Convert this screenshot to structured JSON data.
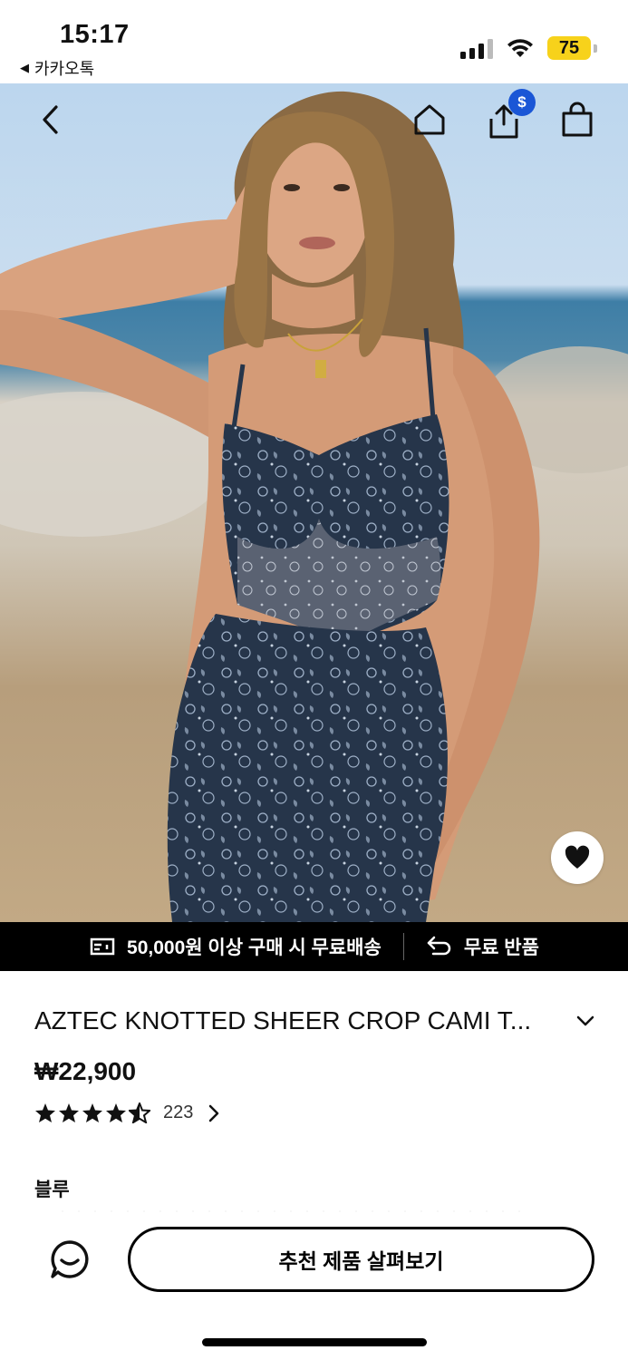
{
  "status_bar": {
    "time": "15:17",
    "back_app_label": "카카오톡",
    "battery_level": "75",
    "battery_color": "#f7d21b",
    "icons": [
      "signal-icon",
      "wifi-icon",
      "battery-icon"
    ]
  },
  "header": {
    "icons": [
      "back-chevron-icon",
      "home-icon",
      "share-icon",
      "shopping-bag-icon"
    ],
    "share_badge": "$",
    "share_badge_color": "#1a56d6"
  },
  "hero": {
    "image_name": "product-photo",
    "wishlist_icon": "heart-icon"
  },
  "promo_bar": {
    "shipping_text": "50,000원 이상 구매 시 무료배송",
    "shipping_icon": "truck-icon",
    "return_text": "무료 반품",
    "return_icon": "return-arrow-icon"
  },
  "product": {
    "title": "AZTEC KNOTTED SHEER CROP CAMI T...",
    "price": "₩22,900",
    "rating": 4.5,
    "rating_max": 5,
    "review_count": "223",
    "color_label": "블루"
  },
  "bottom_bar": {
    "chat_icon": "chat-bubble-icon",
    "recommend_label": "추천 제품 살펴보기"
  }
}
